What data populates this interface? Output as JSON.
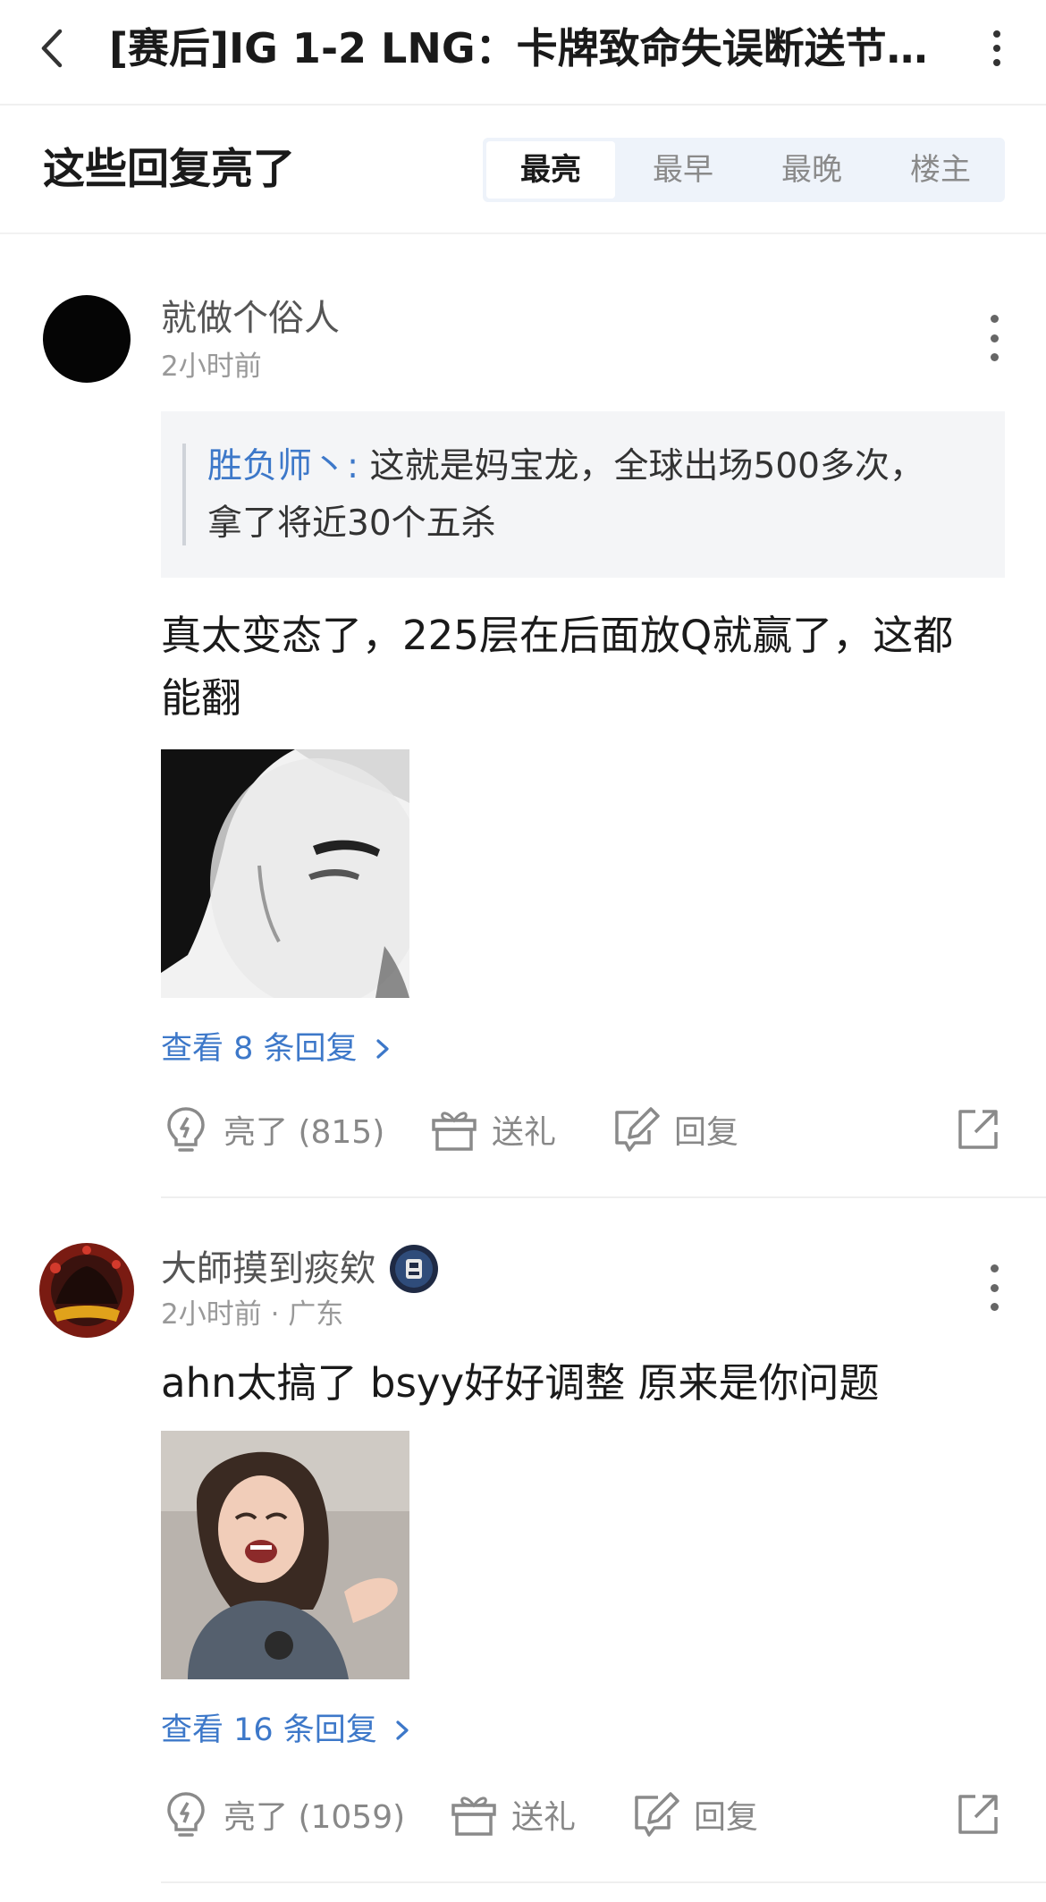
{
  "nav": {
    "title": "[赛后]IG 1-2 LNG：卡牌致命失误断送节…"
  },
  "section": {
    "title": "这些回复亮了",
    "tabs": [
      {
        "label": "最亮",
        "active": true
      },
      {
        "label": "最早",
        "active": false
      },
      {
        "label": "最晚",
        "active": false
      },
      {
        "label": "楼主",
        "active": false
      }
    ]
  },
  "comments": [
    {
      "username": "就做个俗人",
      "meta": "2小时前",
      "quote": {
        "author": "胜负师丶:",
        "text": " 这就是妈宝龙，全球出场500多次，拿了将近30个五杀"
      },
      "body": "真太变态了，225层在后面放Q就赢了，这都能翻",
      "view_replies": "查看 8 条回复",
      "actions": {
        "like": "亮了 (815)",
        "gift": "送礼",
        "reply": "回复"
      }
    },
    {
      "username": "大師摸到痰欸",
      "meta": "2小时前 · 广东",
      "body": "ahn太搞了  bsyy好好调整 原来是你问题",
      "view_replies": "查看 16 条回复",
      "actions": {
        "like": "亮了 (1059)",
        "gift": "送礼",
        "reply": "回复"
      }
    }
  ],
  "colors": {
    "link": "#3d78c9",
    "muted": "#999999",
    "tab_bg": "#eef3fa"
  }
}
